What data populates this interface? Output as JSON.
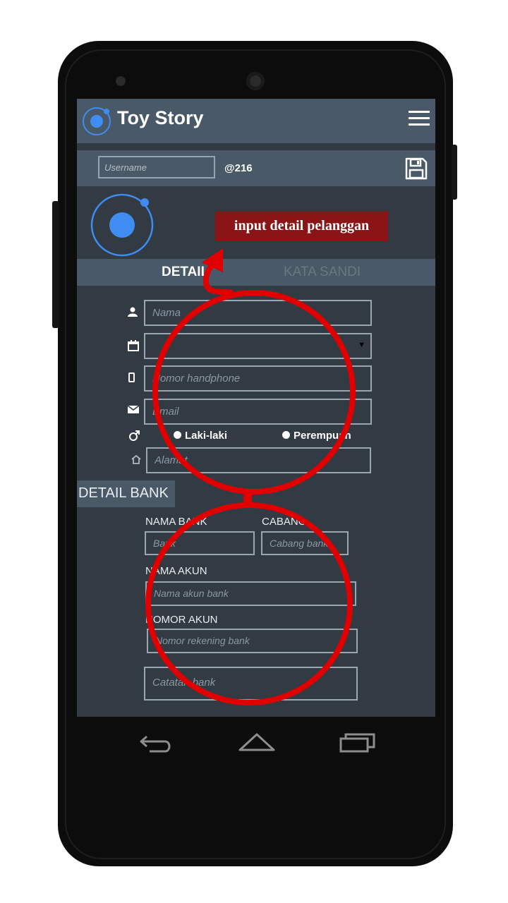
{
  "app": {
    "title": "Toy Story",
    "logo_icon": "ionic-logo-icon",
    "menu_icon": "hamburger-menu-icon"
  },
  "toolbar": {
    "username_placeholder": "Username",
    "user_handle": "@216",
    "save_icon": "save-icon"
  },
  "tabs": [
    {
      "label": "DETAIL",
      "active": true
    },
    {
      "label": "KATA SANDI",
      "active": false
    }
  ],
  "detail_form": {
    "name_placeholder": "Nama",
    "birthdate_value": "",
    "phone_placeholder": "Nomor handphone",
    "email_placeholder": "Email",
    "gender_options": [
      "Laki-laki",
      "Perempuan"
    ],
    "address_placeholder": "Alamat"
  },
  "bank_section": {
    "header": "DETAIL BANK",
    "bank_name_label": "NAMA BANK",
    "bank_name_placeholder": "Bank",
    "branch_label": "CABANG",
    "branch_placeholder": "Cabang bank",
    "account_name_label": "NAMA AKUN",
    "account_name_placeholder": "Nama akun bank",
    "account_number_label": "NOMOR AKUN",
    "account_number_placeholder": "Nomor rekening bank",
    "notes_placeholder": "Catatan bank"
  },
  "annotation": {
    "callout_text": "input detail pelanggan",
    "color": "#e00000"
  },
  "colors": {
    "screen_bg": "#323a43",
    "bar_bg": "#4a5967",
    "accent": "#3f8cf2",
    "callout_bg": "#8b1416"
  }
}
